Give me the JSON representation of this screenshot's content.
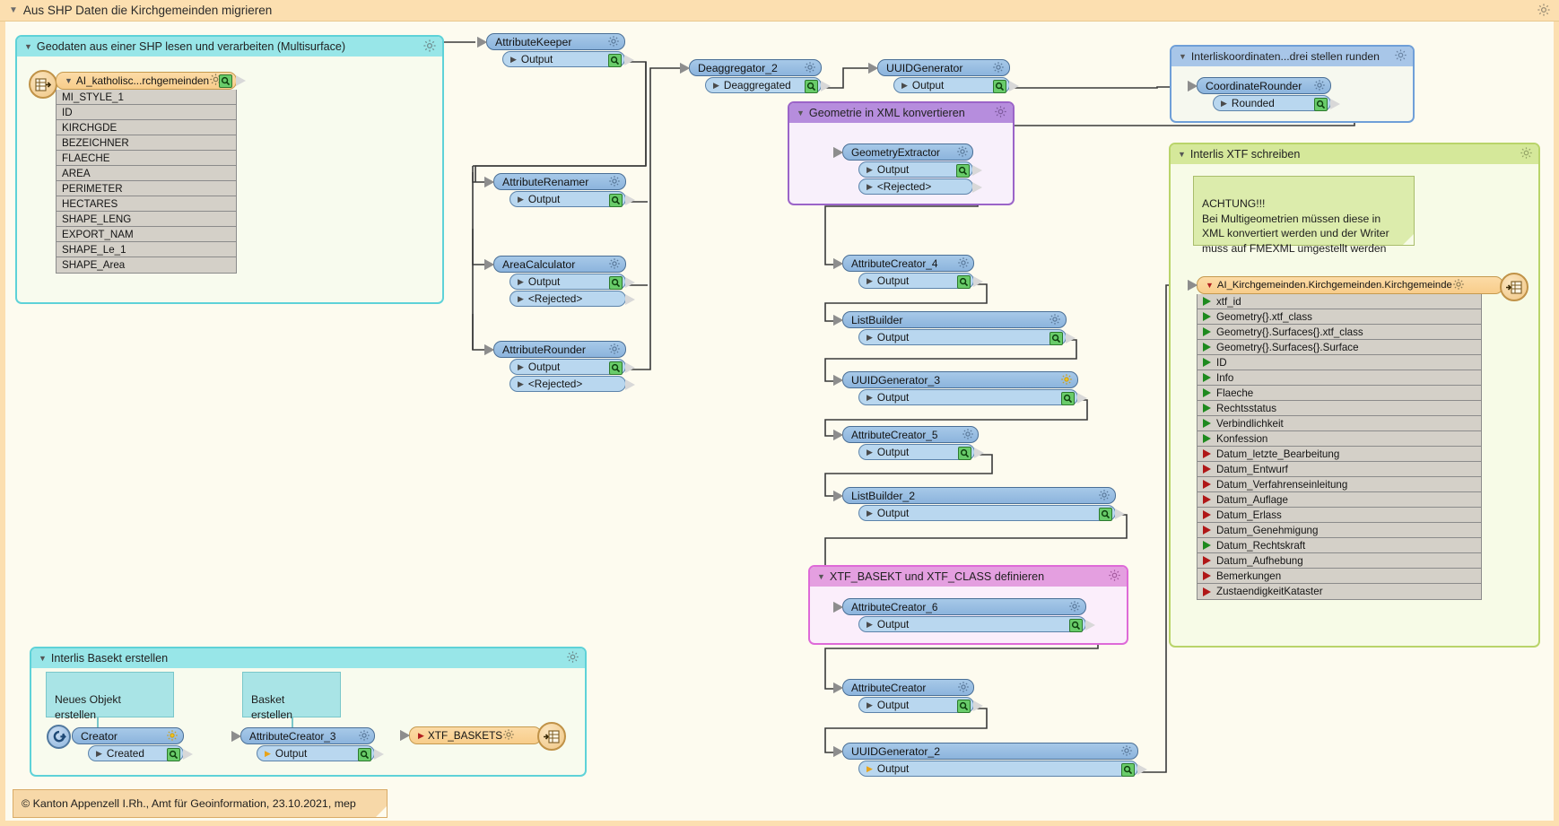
{
  "workspace": {
    "title": "Aus SHP Daten die Kirchgemeinden migrieren",
    "footer_note": "© Kanton Appenzell I.Rh., Amt für Geoinformation, 23.10.2021, mep"
  },
  "groups": {
    "shp_read": {
      "title": "Geodaten aus einer SHP lesen und verarbeiten (Multisurface)"
    },
    "geom_xml": {
      "title": "Geometrie in XML konvertieren"
    },
    "interlis_coord": {
      "title": "Interliskoordinaten...drei stellen runden"
    },
    "interlis_xtf": {
      "title": "Interlis XTF schreiben"
    },
    "xtf_basket_class": {
      "title": "XTF_BASEKT und XTF_CLASS definieren"
    },
    "interlis_basket": {
      "title": "Interlis Basekt erstellen"
    }
  },
  "notes": {
    "achtung": "ACHTUNG!!!\nBei Multigeometrien müssen diese in\nXML konvertiert werden und der Writer\nmuss auf FMEXML umgestellt werden",
    "neues_objekt": "Neues Objekt\nerstellen",
    "basket_erstellen": "Basket\nerstellen"
  },
  "reader": {
    "name": "AI_katholisc...rchgemeinden",
    "attributes": [
      "MI_STYLE_1",
      "ID",
      "KIRCHGDE",
      "BEZEICHNER",
      "FLAECHE",
      "AREA",
      "PERIMETER",
      "HECTARES",
      "SHAPE_LENG",
      "EXPORT_NAM",
      "SHAPE_Le_1",
      "SHAPE_Area"
    ]
  },
  "writer": {
    "name": "AI_Kirchgemeinden.Kirchgemeinden.Kirchgemeinde",
    "attributes": [
      {
        "name": "xtf_id",
        "mark": "green"
      },
      {
        "name": "Geometry{}.xtf_class",
        "mark": "green"
      },
      {
        "name": "Geometry{}.Surfaces{}.xtf_class",
        "mark": "green"
      },
      {
        "name": "Geometry{}.Surfaces{}.Surface",
        "mark": "green"
      },
      {
        "name": "ID",
        "mark": "green"
      },
      {
        "name": "Info",
        "mark": "green"
      },
      {
        "name": "Flaeche",
        "mark": "green"
      },
      {
        "name": "Rechtsstatus",
        "mark": "green"
      },
      {
        "name": "Verbindlichkeit",
        "mark": "green"
      },
      {
        "name": "Konfession",
        "mark": "green"
      },
      {
        "name": "Datum_letzte_Bearbeitung",
        "mark": "red"
      },
      {
        "name": "Datum_Entwurf",
        "mark": "red"
      },
      {
        "name": "Datum_Verfahrenseinleitung",
        "mark": "red"
      },
      {
        "name": "Datum_Auflage",
        "mark": "red"
      },
      {
        "name": "Datum_Erlass",
        "mark": "red"
      },
      {
        "name": "Datum_Genehmigung",
        "mark": "red"
      },
      {
        "name": "Datum_Rechtskraft",
        "mark": "green"
      },
      {
        "name": "Datum_Aufhebung",
        "mark": "red"
      },
      {
        "name": "Bemerkungen",
        "mark": "red"
      },
      {
        "name": "ZustaendigkeitKataster",
        "mark": "red"
      }
    ]
  },
  "basket_writer": {
    "name": "XTF_BASKETS"
  },
  "transformers": [
    {
      "id": "attributekeeper",
      "name": "AttributeKeeper",
      "ports": [
        "Output"
      ]
    },
    {
      "id": "attributerenamer",
      "name": "AttributeRenamer",
      "ports": [
        "Output"
      ]
    },
    {
      "id": "areacalculator",
      "name": "AreaCalculator",
      "ports": [
        "Output",
        "<Rejected>"
      ]
    },
    {
      "id": "attributerounder",
      "name": "AttributeRounder",
      "ports": [
        "Output",
        "<Rejected>"
      ]
    },
    {
      "id": "deaggregator_2",
      "name": "Deaggregator_2",
      "ports": [
        "Deaggregated"
      ]
    },
    {
      "id": "uuidgenerator",
      "name": "UUIDGenerator",
      "ports": [
        "Output"
      ]
    },
    {
      "id": "coordinaterounder",
      "name": "CoordinateRounder",
      "ports": [
        "Rounded"
      ]
    },
    {
      "id": "geometryextractor",
      "name": "GeometryExtractor",
      "ports": [
        "Output",
        "<Rejected>"
      ]
    },
    {
      "id": "attributecreator_4",
      "name": "AttributeCreator_4",
      "ports": [
        "Output"
      ]
    },
    {
      "id": "listbuilder",
      "name": "ListBuilder",
      "ports": [
        "Output"
      ]
    },
    {
      "id": "uuidgenerator_3",
      "name": "UUIDGenerator_3",
      "ports": [
        "Output"
      ]
    },
    {
      "id": "attributecreator_5",
      "name": "AttributeCreator_5",
      "ports": [
        "Output"
      ]
    },
    {
      "id": "listbuilder_2",
      "name": "ListBuilder_2",
      "ports": [
        "Output"
      ]
    },
    {
      "id": "attributecreator_6",
      "name": "AttributeCreator_6",
      "ports": [
        "Output"
      ]
    },
    {
      "id": "attributecreator",
      "name": "AttributeCreator",
      "ports": [
        "Output"
      ]
    },
    {
      "id": "uuidgenerator_2",
      "name": "UUIDGenerator_2",
      "ports": [
        "Output"
      ]
    },
    {
      "id": "creator",
      "name": "Creator",
      "ports": [
        "Created"
      ]
    },
    {
      "id": "attributecreator_3",
      "name": "AttributeCreator_3",
      "ports": [
        "Output"
      ]
    }
  ],
  "colors": {
    "annotation_bar": "#fcdfb0",
    "group_cyan": "#98e6e8",
    "group_purple": "#b68ddd",
    "group_magenta": "#e49fe0",
    "group_blue": "#a8c6e8",
    "group_green": "#d5e89a",
    "transformer_header": "#8cb4dd",
    "transformer_port": "#b9d7ef",
    "feature_type": "#f8cd8b",
    "attr_row": "#d4d0c8",
    "canvas": "#fdfbef"
  }
}
